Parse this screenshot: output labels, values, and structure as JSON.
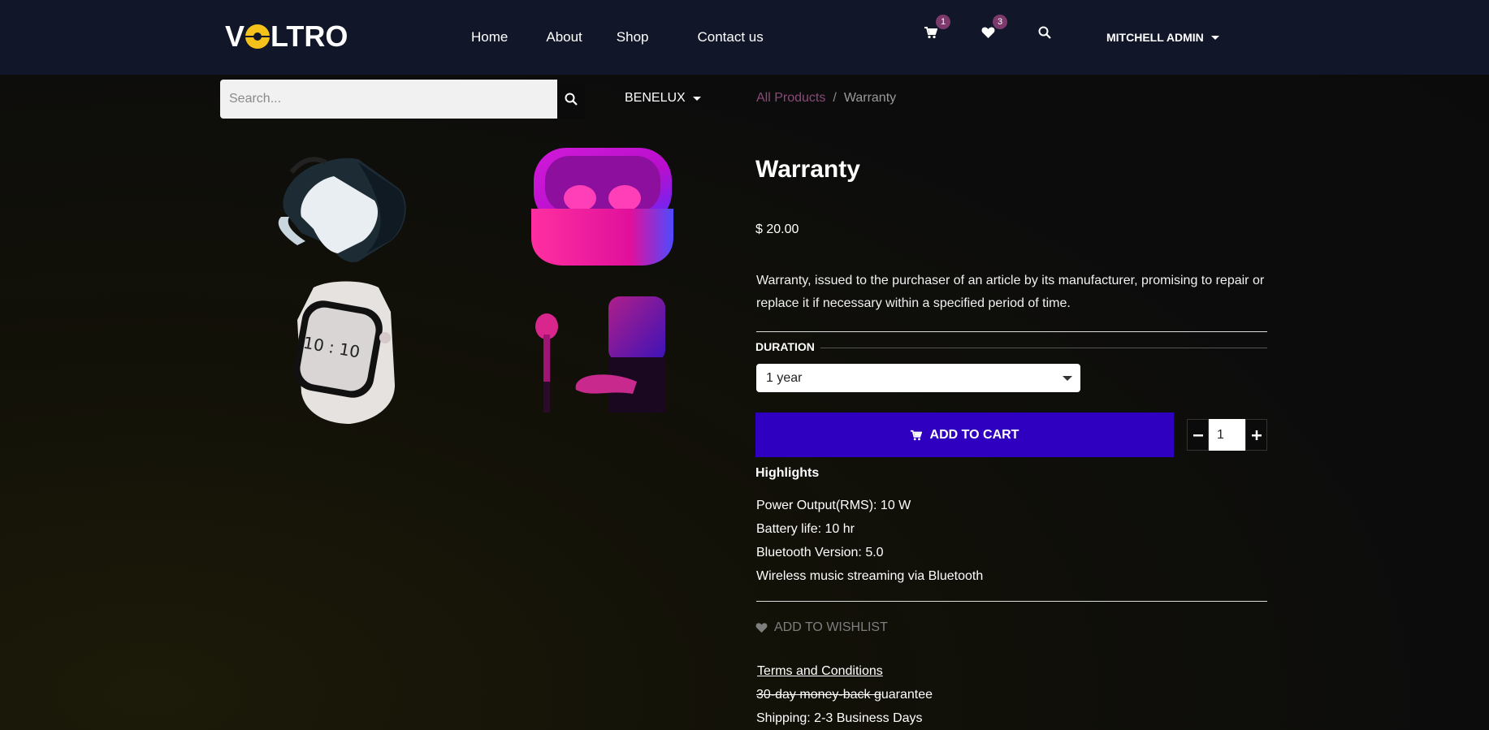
{
  "header": {
    "logo": "VOLTRO",
    "nav": [
      "Home",
      "About",
      "Shop",
      "Contact us"
    ],
    "cart_count": "1",
    "wishlist_count": "3",
    "user_name": "MITCHELL ADMIN",
    "icons": [
      "cart-icon",
      "heart-icon",
      "search-icon"
    ]
  },
  "search": {
    "placeholder": "Search..."
  },
  "pricelist": "BENELUX",
  "breadcrumb": {
    "link": "All Products",
    "separator": "/",
    "current": "Warranty"
  },
  "product": {
    "title": "Warranty",
    "price": "$ 20.00",
    "description": "Warranty, issued to the purchaser of an article by its manufacturer, promising to repair or replace it if necessary within a specified period of time.",
    "duration_label": "DURATION",
    "duration_value": "1 year",
    "add_to_cart": "ADD TO CART",
    "quantity": "1",
    "highlights_title": "Highlights",
    "highlights": [
      "Power Output(RMS): 10 W",
      "Battery life: 10 hr",
      "Bluetooth Version: 5.0",
      "Wireless music streaming via Bluetooth"
    ],
    "wishlist_label": "ADD TO WISHLIST",
    "terms": "Terms and Conditions",
    "moneyback_struck": "30-day money-back g",
    "moneyback_rest": "uarantee",
    "shipping": "Shipping: 2-3 Business Days"
  },
  "gallery": [
    "vr-headset-image",
    "earbuds-case-image",
    "smartwatch-image",
    "earbud-image"
  ],
  "colors": {
    "header_bg": "#111629",
    "accent": "#3000c0",
    "badge": "#7b3a6b",
    "logo_yellow": "#f4c21b"
  }
}
